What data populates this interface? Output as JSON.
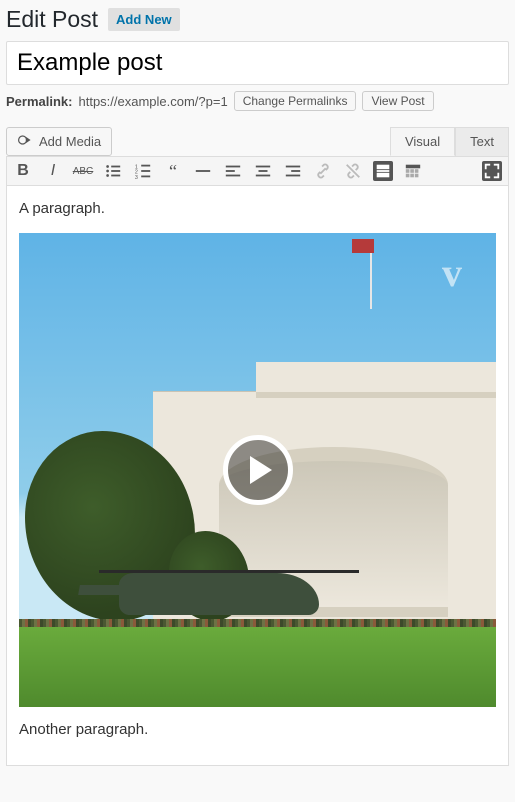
{
  "header": {
    "title": "Edit Post",
    "add_new_label": "Add New"
  },
  "post": {
    "title_value": "Example post"
  },
  "permalink": {
    "label": "Permalink:",
    "url": "https://example.com/?p=1",
    "change_btn": "Change Permalinks",
    "view_btn": "View Post"
  },
  "media_button": "Add Media",
  "tabs": {
    "visual": "Visual",
    "text": "Text",
    "active": "visual"
  },
  "toolbar": {
    "buttons": [
      "bold",
      "italic",
      "strikethrough",
      "bullet-list",
      "number-list",
      "blockquote",
      "hr",
      "align-left",
      "align-center",
      "align-right",
      "link",
      "unlink",
      "read-more",
      "toolbar-toggle",
      "fullscreen"
    ]
  },
  "content": {
    "para1": "A paragraph.",
    "para2": "Another paragraph."
  },
  "embed": {
    "source": "vine",
    "playable": true
  }
}
